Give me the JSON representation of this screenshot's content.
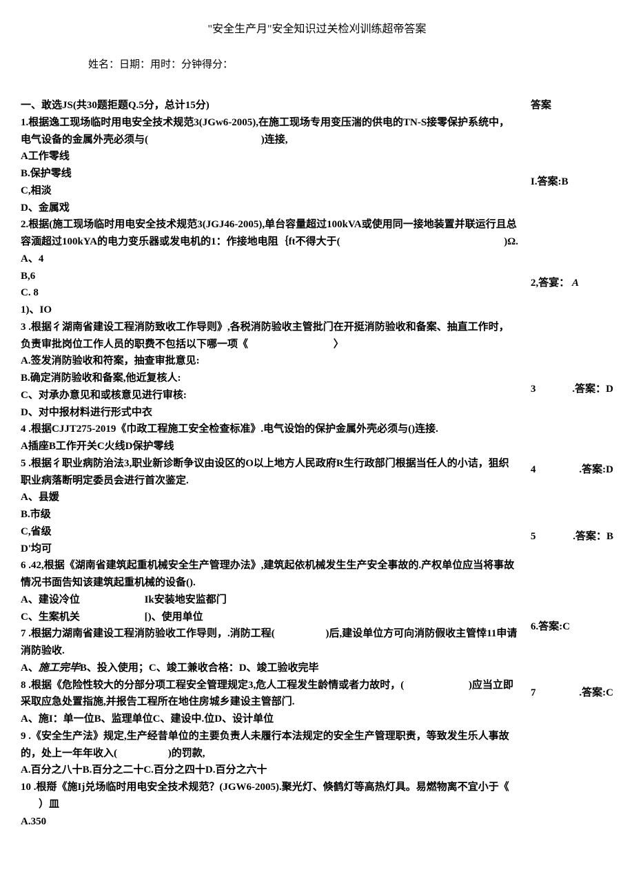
{
  "title": "\"安全生产月\"安全知识过关检刈训练超帝答案",
  "meta": "姓名：日期：用时：分钟得分：",
  "section_heading": "一、敢选JS(共30题拒题Q.5分，总计15分)",
  "side_heading": "答案",
  "q1_stem_a": "1.根据逸工现场临时用电安全技术规范3(JGw6-2005),在施工现场专用变压湍的供电的TN-S接零保护系统中，电气设备的金属外壳必须与(",
  "q1_stem_b": ")连接,",
  "q1_opt_a": "A工作零线",
  "q1_opt_b": "B.保护零线",
  "q1_opt_c": "C,相淡",
  "q1_opt_d": "D、金属戏",
  "ans1": "I.答案:B",
  "q2_stem_a": "2.根据(施工现场临时用电安全技术规范3(JGJ46-2005),单台容量超过100kVA或使用同一接地装置并联运行且总容湎超过100kYA的电力变乐器或发电机的1：作接地电阻｛ft不得大于(",
  "q2_stem_b": ")Ω.",
  "q2_opt_a": "A、4",
  "q2_opt_b": "B,6",
  "q2_opt_c": "C. 8",
  "q2_opt_d": "1)、IO",
  "ans2_a": "2,答宴：",
  "ans2_b": "A",
  "q3_stem_a": "3 .根据彳湖南省建设工程消防致收工作导则》,各税消防验收主管批门在开挺消防验收和备案、抽直工作时，负责审批岗位工作人员的职费不包括以下哪一项《",
  "q3_stem_b": "〉",
  "q3_opt_a": "A.签发消防验收和符案，抽查审批意见:",
  "q3_opt_b": "B.确定消防验收和备案,他近复核人:",
  "q3_opt_c": "C、对承办意见和或核意见进行审核:",
  "q3_opt_d": "D、对中报材料进行形式中衣",
  "ans3_a": "3",
  "ans3_b": ".答案：D",
  "q4_stem": "4 .根据CJJT275-2019《巾政工程施工安全检查标准》.电气设饴的保护金属外壳必须与()连接.",
  "q4_opt": "A插座B工作开关C火线D保护零线",
  "q5_stem": "5 .根据彳职业病防治法3,职业新诊断争议由设区的O以上地方人民政府R生行政部门根据当任人的小诘，狙织职业病落断明定委员会进行首次鉴定.",
  "q5_opt_a": "A、县媛",
  "q5_opt_b": "B.市级",
  "q5_opt_c": "C,省级",
  "q5_opt_d": "D'均可",
  "ans4_a": "4",
  "ans4_b": ".答案:D",
  "q6_stem": "6 .42,根据《湖南省建筑起重机械安全生产管理办法》,建筑起依机械发生生产安全事故的.产权单位应当将事故情况书面告知该建筑起重机械的设备().",
  "q6_opt_line1_a": "A、建设冷位",
  "q6_opt_line1_b": "Ik安装地安监都门",
  "q6_opt_line2_a": "C、生案机关",
  "q6_opt_line2_b": "[)、使用单位",
  "ans5_a": "5",
  "ans5_b": ".答案：B",
  "q7_stem_a": "7 .根据力湖南省建设工程消防验收工作导则，.消防工程(",
  "q7_stem_b": ")后,建设单位方可向消防假收主管悻11申请消防验收.",
  "q7_opt_a": "A、",
  "q7_opt_a_italic": "施工完毕",
  "q7_opt_rest": "B、投入使用；C、竣工兼收合格：D、竣工验收完毕",
  "ans6": "6.答案:C",
  "q8_stem_a": "8 .根据《危险性较大的分部分项工程安全管理规定3,危人工程发生龄情或者力故时，(",
  "q8_stem_b": ")应当立即采取应急处置指施,并报告工程所在地住房城乡建设主管部门.",
  "q8_opt": "A、施I：单一位B、监理单位C、建设中.位D、设计单位",
  "q9_stem_a": "9 .《安全生产法》规定,生产经昔单位的主要负责人未履行本法规定的安全生产管理职责，等致发生乐人事故的，处上一年年收入(",
  "q9_stem_b": ")的罚款,",
  "q9_opt": "A.百分之八十B.百分之二十C.百分之四十D.百分之六十",
  "ans7_a": "7",
  "ans7_b": ".答案:C",
  "q10_stem": "10 .根搿《施Ij兑场临时用电安全技术规范？(JGW6-2005).聚光灯、倏鹤灯等高热灯具。易燃物离不宜小于《",
  "q10_stem_b": "）皿",
  "q10_opt_a": "A.350"
}
